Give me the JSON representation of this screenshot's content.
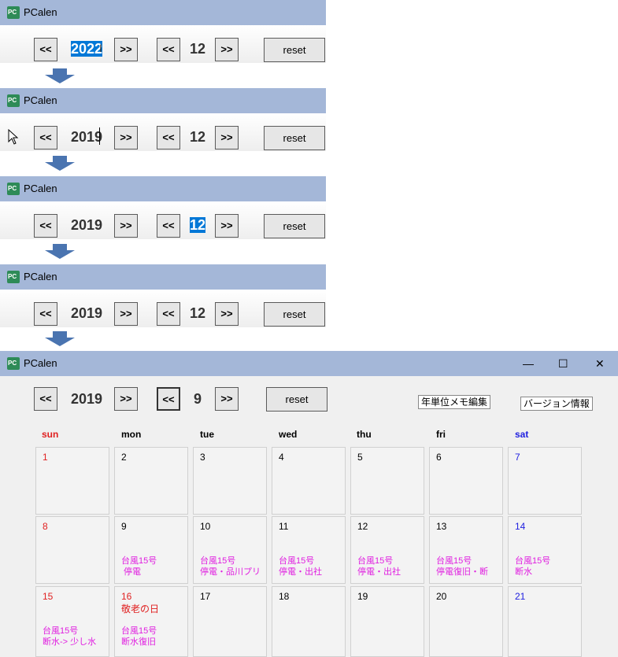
{
  "app": {
    "title": "PCalen",
    "icon_text": "PC"
  },
  "frames": [
    {
      "year": "2022",
      "month": "12",
      "btn_prev": "<<",
      "btn_next": ">>",
      "reset": "reset"
    },
    {
      "year": "2019",
      "month": "12",
      "btn_prev": "<<",
      "btn_next": ">>",
      "reset": "reset"
    },
    {
      "year": "2019",
      "month": "12",
      "btn_prev": "<<",
      "btn_next": ">>",
      "reset": "reset"
    },
    {
      "year": "2019",
      "month": "12",
      "btn_prev": "<<",
      "btn_next": ">>",
      "reset": "reset"
    }
  ],
  "calendar": {
    "year": "2019",
    "month": "9",
    "btn_prev": "<<",
    "btn_next": ">>",
    "reset": "reset",
    "memo_button": "年単位メモ編集",
    "version_button": "バージョン情報",
    "window_controls": {
      "minimize": "—",
      "maximize": "☐",
      "close": "✕"
    },
    "weekdays": [
      "sun",
      "mon",
      "tue",
      "wed",
      "thu",
      "fri",
      "sat"
    ],
    "weeks": [
      [
        {
          "day": "1"
        },
        {
          "day": "2"
        },
        {
          "day": "3"
        },
        {
          "day": "4"
        },
        {
          "day": "5"
        },
        {
          "day": "6"
        },
        {
          "day": "7"
        }
      ],
      [
        {
          "day": "8"
        },
        {
          "day": "9",
          "note1": "台風15号",
          "note2": " 停電"
        },
        {
          "day": "10",
          "note1": "台風15号",
          "note2": "停電・品川プリ"
        },
        {
          "day": "11",
          "note1": "台風15号",
          "note2": "停電・出社"
        },
        {
          "day": "12",
          "note1": "台風15号",
          "note2": "停電・出社"
        },
        {
          "day": "13",
          "note1": "台風15号",
          "note2": "停電復旧・断"
        },
        {
          "day": "14",
          "note1": "台風15号",
          "note2": "断水"
        }
      ],
      [
        {
          "day": "15",
          "note1": "台風15号",
          "note2": "断水-> 少し水"
        },
        {
          "day": "16",
          "holiday": "敬老の日",
          "note1": "台風15号",
          "note2": "断水復旧"
        },
        {
          "day": "17"
        },
        {
          "day": "18"
        },
        {
          "day": "19"
        },
        {
          "day": "20"
        },
        {
          "day": "21"
        }
      ]
    ]
  },
  "colors": {
    "sunday": "#e02020",
    "saturday": "#2020e0",
    "weekday": "#000000",
    "memo": "#e020e0",
    "titlebar": "#a4b7d8",
    "selection": "#0078d7"
  }
}
